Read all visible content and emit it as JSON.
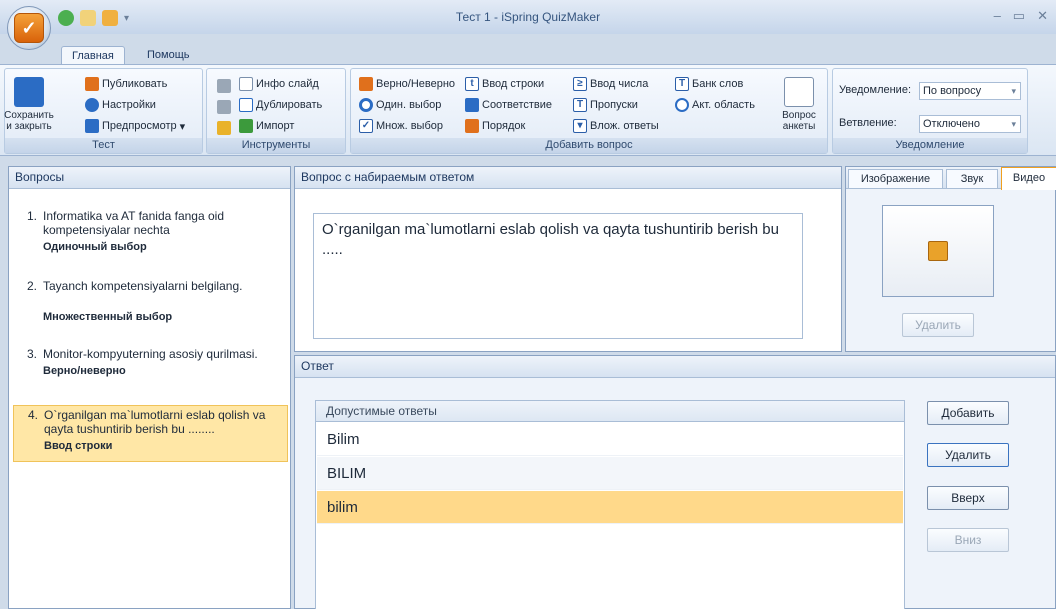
{
  "app": {
    "title": "Тест 1 - iSpring QuizMaker"
  },
  "tabs": {
    "main": "Главная",
    "help": "Помощь"
  },
  "ribbon": {
    "test": {
      "caption": "Тест",
      "save": "Сохранить и закрыть",
      "publish": "Публиковать",
      "settings": "Настройки",
      "preview": "Предпросмотр"
    },
    "tools": {
      "caption": "Инструменты",
      "info": "Инфо слайд",
      "duplicate": "Дублировать",
      "import": "Импорт"
    },
    "add": {
      "caption": "Добавить вопрос",
      "true_false": "Верно/Неверно",
      "single": "Один. выбор",
      "multi": "Множ. выбор",
      "type_in": "Ввод строки",
      "matching": "Соответствие",
      "sequence": "Порядок",
      "numeric": "Ввод числа",
      "fill_gaps": "Пропуски",
      "nested": "Влож. ответы",
      "word_bank": "Банк слов",
      "hotspot": "Акт. область",
      "survey": "Вопрос анкеты"
    },
    "notify": {
      "caption": "Уведомление",
      "feedback_label": "Уведомление:",
      "feedback_value": "По вопросу",
      "branching_label": "Ветвление:",
      "branching_value": "Отключено"
    }
  },
  "questions": {
    "header": "Вопросы",
    "items": [
      {
        "num": "1.",
        "text": "Informatika va AT fanida fanga oid kompetensiyalar nechta",
        "type": "Одиночный выбор"
      },
      {
        "num": "2.",
        "text": "Tayanch kompetensiyalarni belgilang.",
        "type": "Множественный выбор"
      },
      {
        "num": "3.",
        "text": "Monitor-kompyuterning asosiy qurilmasi.",
        "type": "Верно/неверно"
      },
      {
        "num": "4.",
        "text": "O`rganilgan ma`lumotlarni eslab qolish va qayta tushuntirib berish bu ........",
        "type": "Ввод строки"
      }
    ]
  },
  "question": {
    "header": "Вопрос с набираемым ответом",
    "text": "O`rganilgan ma`lumotlarni eslab qolish va qayta tushuntirib berish bu ....."
  },
  "media": {
    "tabs": [
      "Изображение",
      "Звук",
      "Видео"
    ],
    "delete": "Удалить"
  },
  "answer": {
    "header": "Ответ",
    "list_header": "Допустимые ответы",
    "items": [
      "Bilim",
      "BILIM",
      "bilim"
    ],
    "add": "Добавить",
    "delete": "Удалить",
    "up": "Вверх",
    "down": "Вниз"
  }
}
